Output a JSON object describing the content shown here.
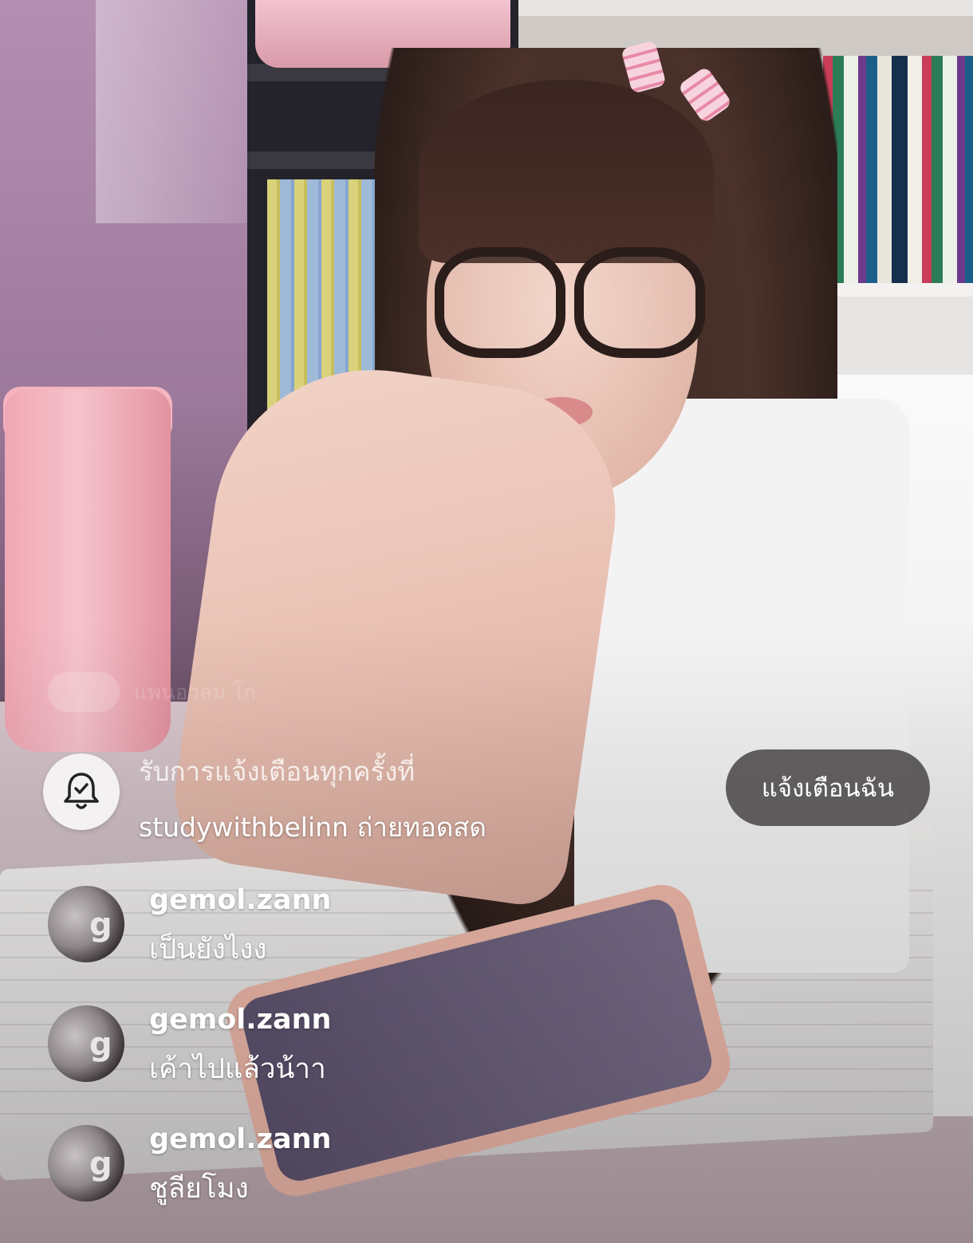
{
  "ghost_comment": {
    "text": "แพนอวลม โก"
  },
  "notification": {
    "line1": "รับการแจ้งเตือนทุกครั้งที่",
    "line2": "studywithbelinn ถ่ายทอดสด",
    "button_label": "แจ้งเตือนฉัน",
    "icon": "bell-check-icon"
  },
  "comments": [
    {
      "username": "gemol.zann",
      "text": "เป็นยังไงง",
      "avatar_glyph": "g"
    },
    {
      "username": "gemol.zann",
      "text": "เค้าไปแล้วน้าา",
      "avatar_glyph": "g"
    },
    {
      "username": "gemol.zann",
      "text": "ชูลียโมง",
      "avatar_glyph": "g"
    }
  ],
  "colors": {
    "button_bg": "#2d282a",
    "text": "#ffffff"
  }
}
